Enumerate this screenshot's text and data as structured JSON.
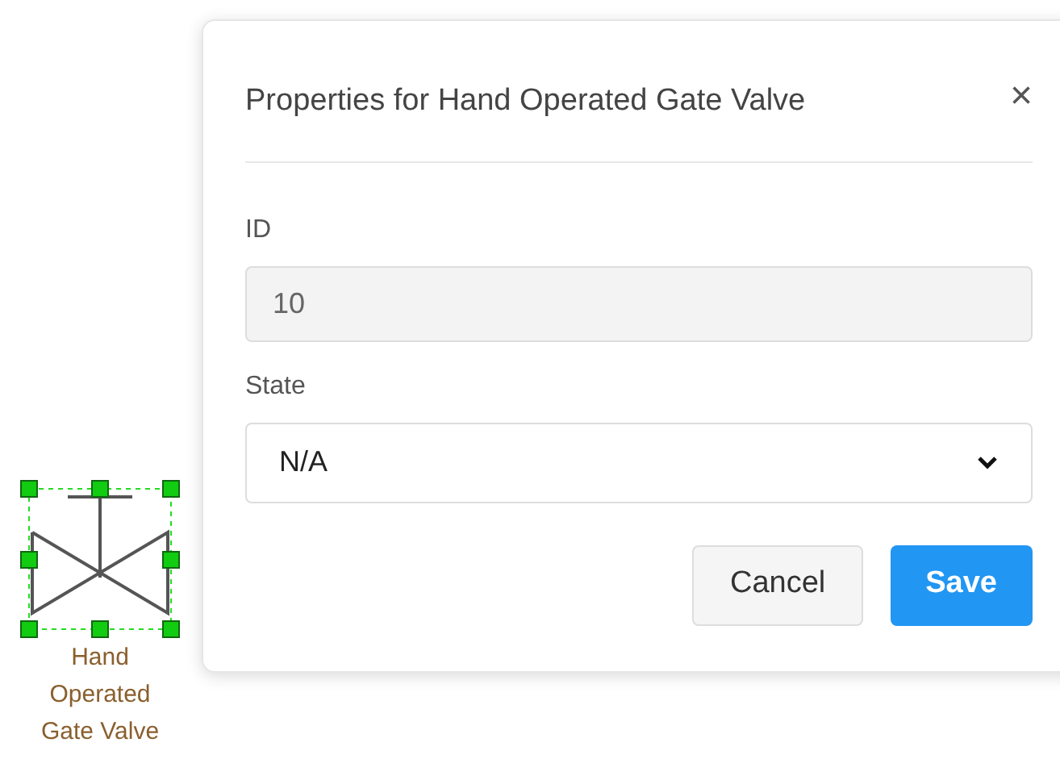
{
  "canvas": {
    "shape": {
      "label": "Hand Operated Gate Valve",
      "selected": true
    }
  },
  "dialog": {
    "title": "Properties for Hand Operated Gate Valve",
    "close": "×",
    "fields": [
      {
        "kind": "text",
        "label": "ID",
        "value": "10",
        "disabled": true
      },
      {
        "kind": "select",
        "label": "State",
        "value": "N/A",
        "disabled": false
      }
    ],
    "buttons": [
      {
        "label": "Cancel",
        "kind": "secondary"
      },
      {
        "label": "Save",
        "kind": "primary"
      }
    ]
  }
}
